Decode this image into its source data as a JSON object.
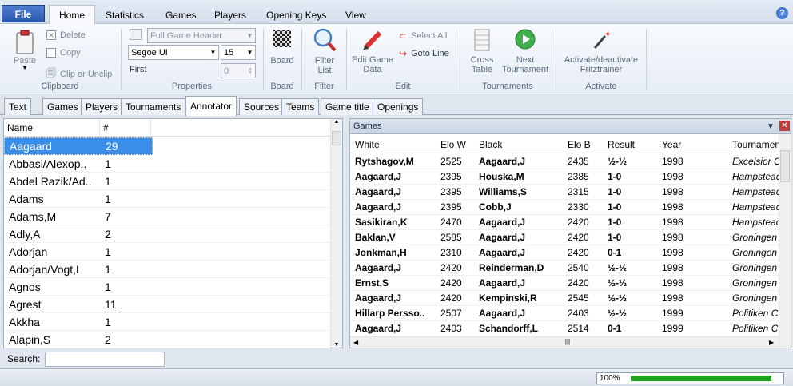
{
  "menu": {
    "file": "File",
    "tabs": [
      "Home",
      "Statistics",
      "Games",
      "Players",
      "Opening Keys",
      "View"
    ],
    "help": "?"
  },
  "ribbon": {
    "clipboard": {
      "paste": "Paste",
      "delete": "Delete",
      "copy": "Copy",
      "clip": "Clip or Unclip",
      "group": "Clipboard"
    },
    "properties": {
      "header_combo": "Full Game Header",
      "font_combo": "Segoe UI",
      "size_combo": "15",
      "first_label": "First",
      "first_value": "0",
      "group": "Properties"
    },
    "board": {
      "label": "Board",
      "group": "Board"
    },
    "filter": {
      "label": "Filter List",
      "group": "Filter"
    },
    "edit": {
      "edit_game": "Edit Game Data",
      "select_all": "Select All",
      "goto_line": "Goto Line",
      "group": "Edit"
    },
    "tournaments": {
      "cross": "Cross Table",
      "next": "Next Tournament",
      "group": "Tournaments"
    },
    "activate": {
      "label": "Activate/deactivate Fritztrainer",
      "group": "Activate"
    }
  },
  "subtabs": [
    "Text",
    "Games",
    "Players",
    "Tournaments",
    "Annotator",
    "Sources",
    "Teams",
    "Game title",
    "Openings"
  ],
  "annotators": {
    "col_name": "Name",
    "col_count": "#",
    "rows": [
      {
        "name": "Aagaard",
        "count": "29"
      },
      {
        "name": "Abbasi/Alexop..",
        "count": "1"
      },
      {
        "name": "Abdel Razik/Ad..",
        "count": "1"
      },
      {
        "name": "Adams",
        "count": "1"
      },
      {
        "name": "Adams,M",
        "count": "7"
      },
      {
        "name": "Adly,A",
        "count": "2"
      },
      {
        "name": "Adorjan",
        "count": "1"
      },
      {
        "name": "Adorjan/Vogt,L",
        "count": "1"
      },
      {
        "name": "Agnos",
        "count": "1"
      },
      {
        "name": "Agrest",
        "count": "11"
      },
      {
        "name": "Akkha",
        "count": "1"
      },
      {
        "name": "Alapin,S",
        "count": "2"
      }
    ],
    "search_label": "Search:",
    "search_value": ""
  },
  "games": {
    "title": "Games",
    "columns": [
      "White",
      "Elo W",
      "Black",
      "Elo B",
      "Result",
      "Year",
      "Tournamen"
    ],
    "rows": [
      [
        "Rytshagov,M",
        "2525",
        "Aagaard,J",
        "2435",
        "½-½",
        "1998",
        "Excelsior C"
      ],
      [
        "Aagaard,J",
        "2395",
        "Houska,M",
        "2385",
        "1-0",
        "1998",
        "Hampsteac"
      ],
      [
        "Aagaard,J",
        "2395",
        "Williams,S",
        "2315",
        "1-0",
        "1998",
        "Hampsteac"
      ],
      [
        "Aagaard,J",
        "2395",
        "Cobb,J",
        "2330",
        "1-0",
        "1998",
        "Hampsteac"
      ],
      [
        "Sasikiran,K",
        "2470",
        "Aagaard,J",
        "2420",
        "1-0",
        "1998",
        "Hampsteac"
      ],
      [
        "Baklan,V",
        "2585",
        "Aagaard,J",
        "2420",
        "1-0",
        "1998",
        "Groningen"
      ],
      [
        "Jonkman,H",
        "2310",
        "Aagaard,J",
        "2420",
        "0-1",
        "1998",
        "Groningen"
      ],
      [
        "Aagaard,J",
        "2420",
        "Reinderman,D",
        "2540",
        "½-½",
        "1998",
        "Groningen"
      ],
      [
        "Ernst,S",
        "2420",
        "Aagaard,J",
        "2420",
        "½-½",
        "1998",
        "Groningen"
      ],
      [
        "Aagaard,J",
        "2420",
        "Kempinski,R",
        "2545",
        "½-½",
        "1998",
        "Groningen"
      ],
      [
        "Hillarp Persso..",
        "2507",
        "Aagaard,J",
        "2403",
        "½-½",
        "1999",
        "Politiken C"
      ],
      [
        "Aagaard,J",
        "2403",
        "Schandorff,L",
        "2514",
        "0-1",
        "1999",
        "Politiken C"
      ]
    ]
  },
  "status": {
    "progress_text": "100%",
    "progress": 1.0
  },
  "colors": {
    "accent": "#3b8ee8",
    "progress": "#1fa31f"
  }
}
